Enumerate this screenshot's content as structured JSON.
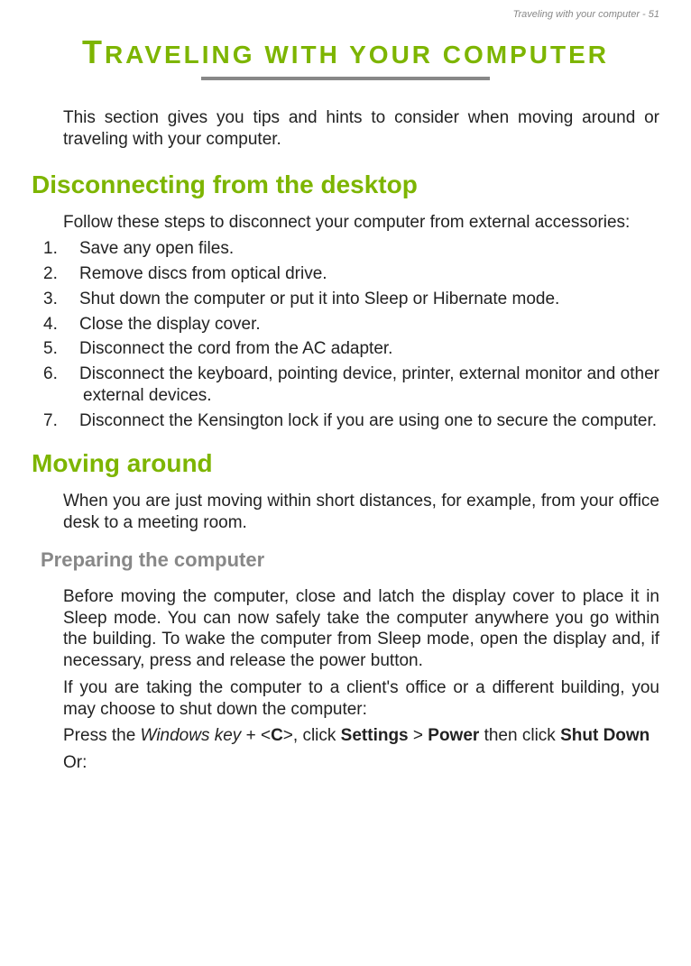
{
  "header": {
    "text": "Traveling with your computer - 51"
  },
  "chapter": {
    "title_rest": "RAVELING WITH YOUR COMPUTER"
  },
  "intro": {
    "text": "This section gives you tips and hints to consider when moving around or traveling with your computer."
  },
  "section1": {
    "title": "Disconnecting from the desktop",
    "intro": "Follow these steps to disconnect your computer from external accessories:",
    "steps": [
      "Save any open files.",
      "Remove discs from optical drive.",
      "Shut down the computer or put it into Sleep or Hibernate mode.",
      "Close the display cover.",
      "Disconnect the cord from the AC adapter.",
      "Disconnect the keyboard, pointing device, printer, external monitor and other external devices.",
      "Disconnect the Kensington lock if you are using one to secure the computer."
    ]
  },
  "section2": {
    "title": "Moving around",
    "intro": "When you are just moving within short distances, for example, from your office desk to a meeting room.",
    "subsection1": {
      "title": "Preparing the computer",
      "para1": "Before moving the computer, close and latch the display cover to place it in Sleep mode. You can now safely take the computer anywhere you go within the building. To wake the computer from Sleep mode, open the display and, if necessary, press and release the power button.",
      "para2": "If you are taking the computer to a client's office or a different building, you may choose to shut down the computer:",
      "instruction": {
        "pre": "Press the ",
        "italic": "Windows key",
        "mid1": " + <",
        "bold_c": "C",
        "mid2": ">, click ",
        "bold_settings": "Settings",
        "mid3": " > ",
        "bold_power": "Power",
        "mid4": " then click ",
        "bold_shutdown": "Shut Down"
      },
      "or_text": "Or:"
    }
  }
}
